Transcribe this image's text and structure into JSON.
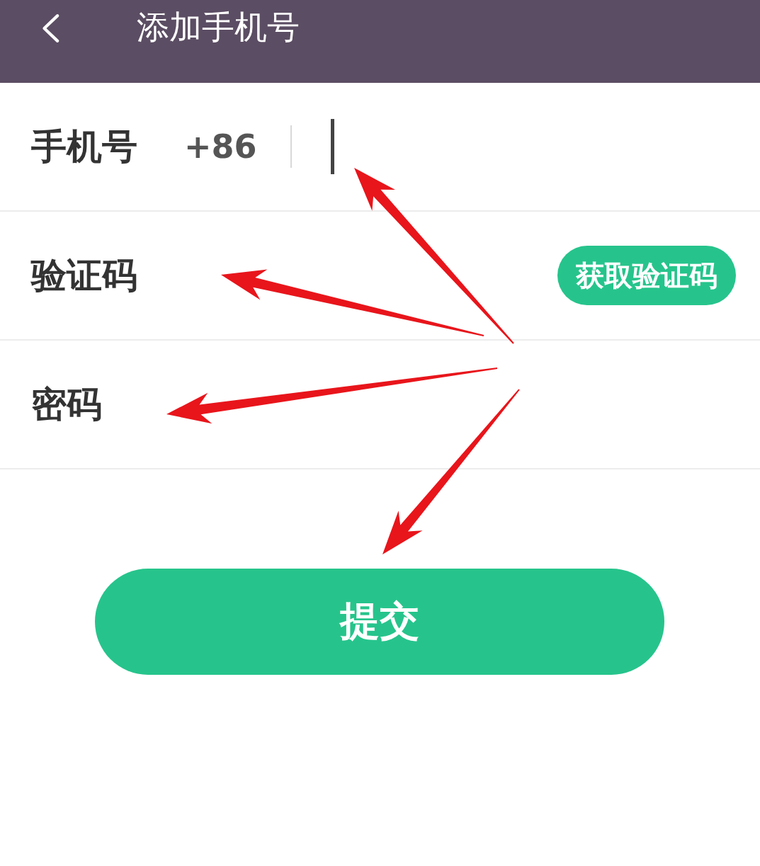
{
  "header": {
    "title": "添加手机号"
  },
  "fields": [
    {
      "kind": "phone",
      "label": "手机号",
      "prefix": "+86",
      "focused": true
    },
    {
      "kind": "code",
      "label": "验证码",
      "action": "获取验证码"
    },
    {
      "kind": "password",
      "label": "密码"
    }
  ],
  "submit": "提交"
}
